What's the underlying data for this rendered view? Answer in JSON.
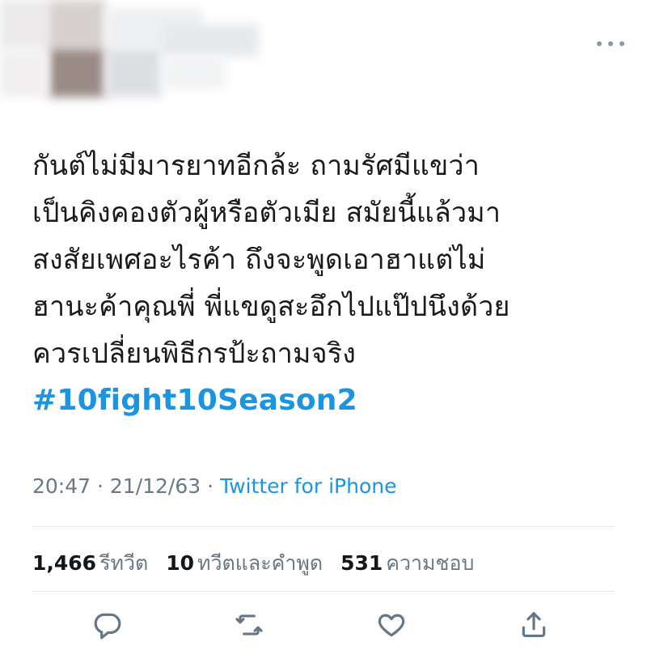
{
  "tweet": {
    "lines": [
      "กันต์ไม่มีมารยาทอีกล้ะ ถามรัศมีแขว่า",
      "เป็นคิงคองตัวผู้หรือตัวเมีย สมัยนี้แล้วมา",
      "สงสัยเพศอะไรค้า ถึงจะพูดเอาฮาแต่ไม่",
      "ฮานะค้าคุณพี่ พี่แขดูสะอึกไปแป๊ปนึงด้วย",
      "ควรเปลี่ยนพิธีกรป้ะถามจริง"
    ],
    "hashtag": "#10fight10Season2"
  },
  "meta": {
    "time": "20:47",
    "separator1": " · ",
    "date": "21/12/63",
    "separator2": " · ",
    "source": "Twitter for iPhone"
  },
  "stats": {
    "retweets_count": "1,466",
    "retweets_label": "รีทวีต",
    "quotes_count": "10",
    "quotes_label": "ทวีตและคำพูด",
    "likes_count": "531",
    "likes_label": "ความชอบ"
  },
  "icons": {
    "more": "more-options-icon",
    "reply": "reply-icon",
    "retweet": "retweet-icon",
    "like": "heart-icon",
    "share": "share-icon"
  },
  "colors": {
    "link": "#1b95e0",
    "secondary_text": "#697882",
    "divider": "#e1e8ed",
    "icon": "#657786"
  }
}
